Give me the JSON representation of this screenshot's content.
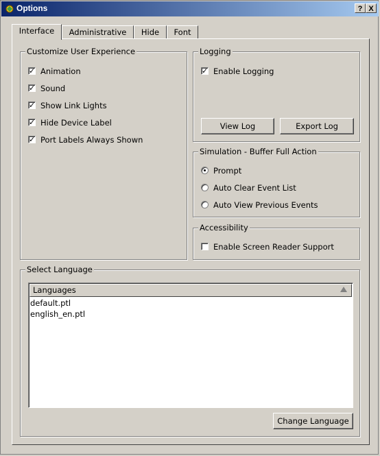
{
  "window": {
    "title": "Options",
    "help_label": "?",
    "close_label": "X"
  },
  "tabs": [
    {
      "label": "Interface"
    },
    {
      "label": "Administrative"
    },
    {
      "label": "Hide"
    },
    {
      "label": "Font"
    }
  ],
  "customize": {
    "title": "Customize User Experience",
    "items": [
      {
        "label": "Animation",
        "checked": true
      },
      {
        "label": "Sound",
        "checked": true
      },
      {
        "label": "Show Link Lights",
        "checked": true
      },
      {
        "label": "Hide Device Label",
        "checked": true
      },
      {
        "label": "Port Labels Always Shown",
        "checked": true
      }
    ]
  },
  "logging": {
    "title": "Logging",
    "enable_label": "Enable Logging",
    "enable_checked": true,
    "view_log_label": "View Log",
    "export_log_label": "Export Log"
  },
  "simulation": {
    "title": "Simulation - Buffer Full Action",
    "options": [
      {
        "label": "Prompt",
        "selected": true
      },
      {
        "label": "Auto Clear Event List",
        "selected": false
      },
      {
        "label": "Auto View Previous Events",
        "selected": false
      }
    ]
  },
  "accessibility": {
    "title": "Accessibility",
    "screen_reader_label": "Enable Screen Reader Support",
    "screen_reader_checked": false
  },
  "language": {
    "title": "Select Language",
    "column_header": "Languages",
    "items": [
      "default.ptl",
      "english_en.ptl"
    ],
    "change_label": "Change Language"
  }
}
